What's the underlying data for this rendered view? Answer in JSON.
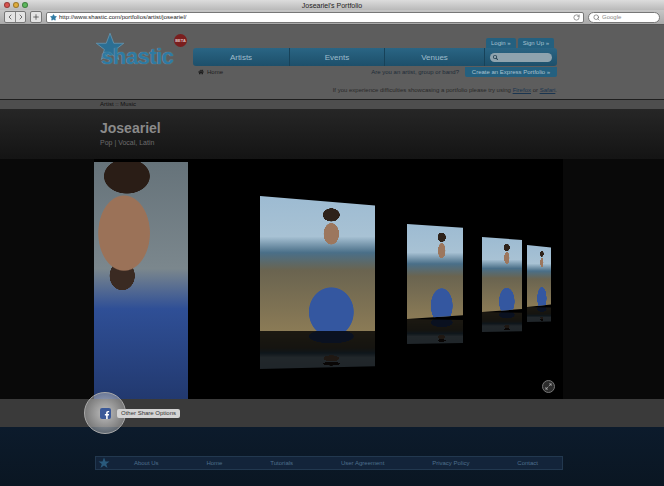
{
  "window": {
    "title": "Joseariel's Portfolio"
  },
  "toolbar": {
    "url": "http://www.shastic.com/portfolios/artist/joseariel/",
    "search_placeholder": "Google"
  },
  "logo": {
    "text": "shastic",
    "badge": "BETA"
  },
  "account_buttons": [
    "Login »",
    "Sign Up »"
  ],
  "nav": [
    {
      "label": "Artists",
      "selected": false
    },
    {
      "label": "Events",
      "selected": false
    },
    {
      "label": "Venues",
      "selected": false
    }
  ],
  "home_link": "Home",
  "promo": {
    "text": "Are you an artist, group or band?",
    "button": "Create an Express Portfolio »"
  },
  "notice": {
    "before": "If you experience difficulties showcasing a portfolio please try using ",
    "link1": "Firefox",
    "middle": " or ",
    "link2": "Safari",
    "after": "."
  },
  "breadcrumb": "Artist :: Music",
  "artist": {
    "name": "Joseariel",
    "genres": "Pop | Vocal, Latin"
  },
  "share": {
    "facebook_highlighted": true,
    "other": "Other Share Options"
  },
  "footer_links": [
    "About Us",
    "Home",
    "Tutorials",
    "User Agreement",
    "Privacy Policy",
    "Contact"
  ]
}
